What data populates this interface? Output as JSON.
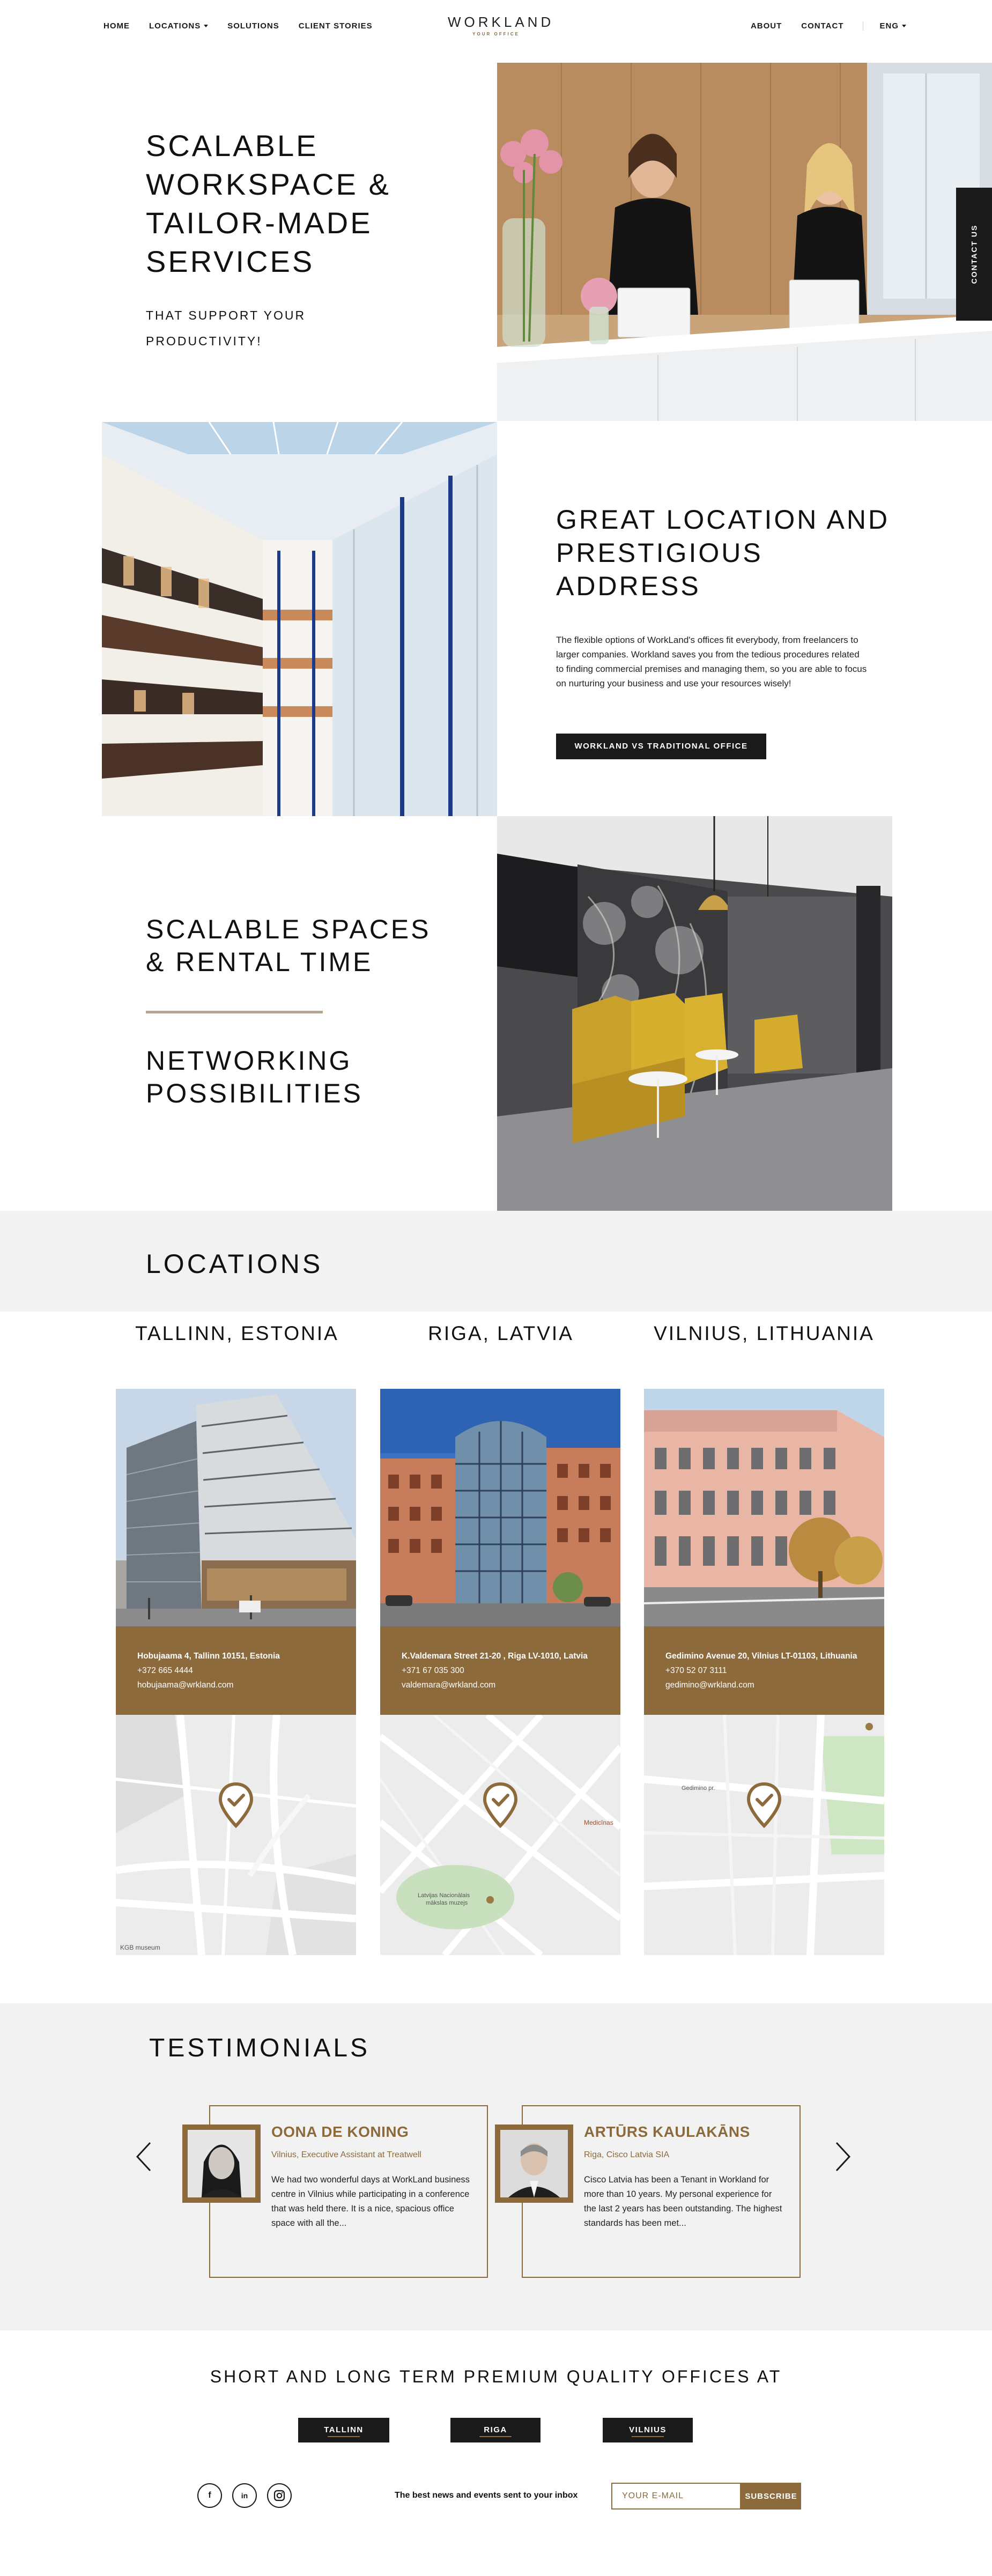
{
  "header": {
    "logo": "WORKLAND",
    "logo_sub": "YOUR OFFICE",
    "nav_left": [
      "HOME",
      "LOCATIONS",
      "SOLUTIONS",
      "CLIENT STORIES"
    ],
    "nav_right": [
      "ABOUT",
      "CONTACT"
    ],
    "lang": "ENG"
  },
  "hero": {
    "title": "SCALABLE WORKSPACE & TAILOR-MADE SERVICES",
    "subtitle": "THAT SUPPORT YOUR PRODUCTIVITY!",
    "contact_tab": "CONTACT US"
  },
  "location_section": {
    "title": "GREAT LOCATION AND PRESTIGIOUS ADDRESS",
    "description": "The flexible options of WorkLand's offices fit everybody, from freelancers to larger companies. Workland saves you from the tedious procedures related to finding commercial premises and managing them, so you are able to focus on nurturing your business and use your resources wisely!",
    "button": "WORKLAND VS TRADITIONAL OFFICE"
  },
  "features": {
    "title1": "SCALABLE SPACES & RENTAL TIME",
    "title2": "NETWORKING POSSIBILITIES"
  },
  "locations": {
    "title": "LOCATIONS",
    "cities": [
      {
        "name": "TALLINN, ESTONIA",
        "address": "Hobujaama 4, Tallinn 10151, Estonia",
        "phone": "+372 665 4444",
        "email": "hobujaama@wrkland.com",
        "map_poi": "KGB museum"
      },
      {
        "name": "RIGA, LATVIA",
        "address": "K.Valdemara Street 21-20 , Riga LV-1010, Latvia",
        "phone": "+371 67 035 300",
        "email": "valdemara@wrkland.com",
        "map_poi": "Medicīnas"
      },
      {
        "name": "VILNIUS, LITHUANIA",
        "address": "Gedimino Avenue 20, Vilnius LT-01103, Lithuania",
        "phone": "+370 52 07 3111",
        "email": "gedimino@wrkland.com",
        "map_poi": "Gedimino pr."
      }
    ]
  },
  "testimonials": {
    "title": "TESTIMONIALS",
    "items": [
      {
        "name": "OONA DE KONING",
        "role": "Vilnius, Executive Assistant at Treatwell",
        "text": "We had two wonderful days at WorkLand business centre in Vilnius while participating in a conference that was held there. It is a nice, spacious office space with all the..."
      },
      {
        "name": "ARTŪRS KAULAKĀNS",
        "role": "Riga, Cisco Latvia SIA",
        "text": "Cisco Latvia has been a Tenant in Workland for more than 10 years. My personal experience for the last 2 years has been outstanding. The highest standards has been met..."
      }
    ]
  },
  "footer": {
    "offices_title": "SHORT AND LONG TERM PREMIUM QUALITY OFFICES AT",
    "offices": [
      "TALLINN",
      "RIGA",
      "VILNIUS"
    ],
    "news_label": "The best news and events sent to your inbox",
    "email_placeholder": "YOUR E-MAIL",
    "subscribe": "SUBSCRIBE",
    "social": [
      "f",
      "in",
      "ig"
    ]
  },
  "colors": {
    "accent": "#8c6a3c",
    "dark": "#1a1a1a",
    "band": "#f2f2f2"
  }
}
